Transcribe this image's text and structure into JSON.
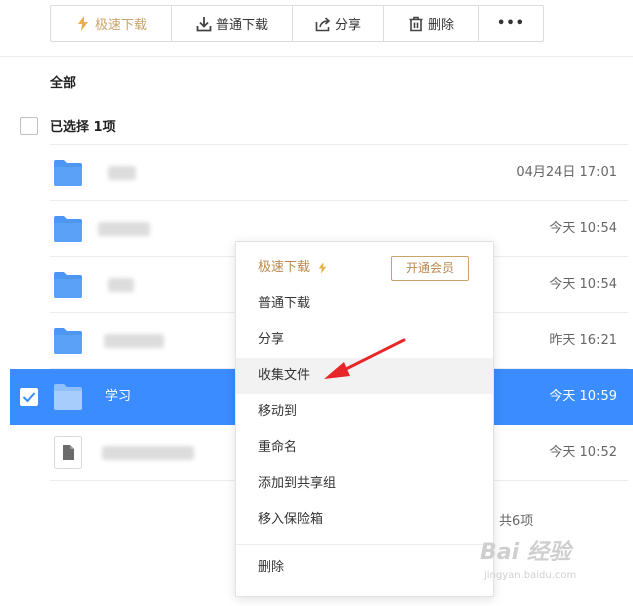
{
  "toolbar": {
    "speed_download": "极速下载",
    "normal_download": "普通下载",
    "share": "分享",
    "delete": "删除",
    "more": "•••"
  },
  "breadcrumb": "全部",
  "selection": {
    "label": "已选择 1项"
  },
  "files": [
    {
      "icon": "folder-icon",
      "name": "",
      "time": "04月24日 17:01",
      "selected": false
    },
    {
      "icon": "folder-icon",
      "name": "",
      "time": "今天 10:54",
      "selected": false
    },
    {
      "icon": "folder-icon",
      "name": "",
      "time": "今天 10:54",
      "selected": false
    },
    {
      "icon": "folder-icon",
      "name": "",
      "time": "昨天 16:21",
      "selected": false
    },
    {
      "icon": "folder-icon",
      "name": "学习",
      "time": "今天 10:59",
      "selected": true
    },
    {
      "icon": "document-icon",
      "name": "",
      "time": "今天 10:52",
      "selected": false
    }
  ],
  "total": "共6项",
  "context_menu": {
    "speed_download": "极速下载",
    "vip_button": "开通会员",
    "items": [
      "普通下载",
      "分享",
      "收集文件",
      "移动到",
      "重命名",
      "添加到共享组",
      "移入保险箱"
    ],
    "delete": "删除"
  },
  "watermark": {
    "logo": "Bai 经验",
    "url": "jingyan.baidu.com"
  },
  "colors": {
    "accent": "#3b8cff",
    "gold": "#c8a36a",
    "arrow": "#e8262a",
    "folder": "#4d96f3"
  }
}
